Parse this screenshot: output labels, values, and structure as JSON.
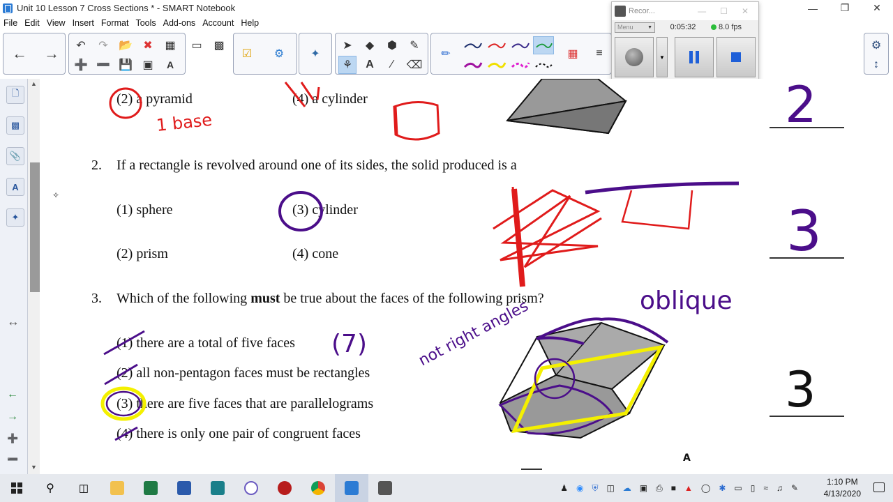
{
  "window": {
    "title": "Unit 10 Lesson 7 Cross Sections * - SMART Notebook"
  },
  "menu": [
    "File",
    "Edit",
    "View",
    "Insert",
    "Format",
    "Tools",
    "Add-ons",
    "Account",
    "Help"
  ],
  "recorder": {
    "title": "Recor...",
    "menu_label": "Menu",
    "elapsed": "0:05:32",
    "fps": "8.0 fps"
  },
  "questions": {
    "q1": {
      "opt2": "(2) a pyramid",
      "opt4": "(4) a cylinder"
    },
    "q2": {
      "number": "2.",
      "text": "If a rectangle is revolved around one of its sides, the solid produced is a",
      "opt1": "(1) sphere",
      "opt3": "(3) cylinder",
      "opt2": "(2) prism",
      "opt4": "(4) cone"
    },
    "q3": {
      "number": "3.",
      "text_pre": "Which of the following ",
      "text_bold": "must",
      "text_post": " be true about the faces of the following prism?",
      "opt1": "(1) there are a total of five faces",
      "opt2": "(2) all non-pentagon faces must be rectangles",
      "opt3": "(3) there are five faces that are parallelograms",
      "opt4": "(4) there is only one pair of congruent faces"
    }
  },
  "annotations": {
    "q1_note": "1 base",
    "answers": [
      "2",
      "3",
      "3"
    ],
    "oblique": "oblique",
    "not_right_angles": "not right angles",
    "seven": "(7)",
    "marker_letter": "A"
  },
  "clock": {
    "time": "1:10 PM",
    "date": "4/13/2020"
  },
  "colors": {
    "red_ink": "#e01b1b",
    "purple_ink": "#4b0e8a",
    "yellow_ink": "#f4f000",
    "selection": "#bcd7f2"
  }
}
